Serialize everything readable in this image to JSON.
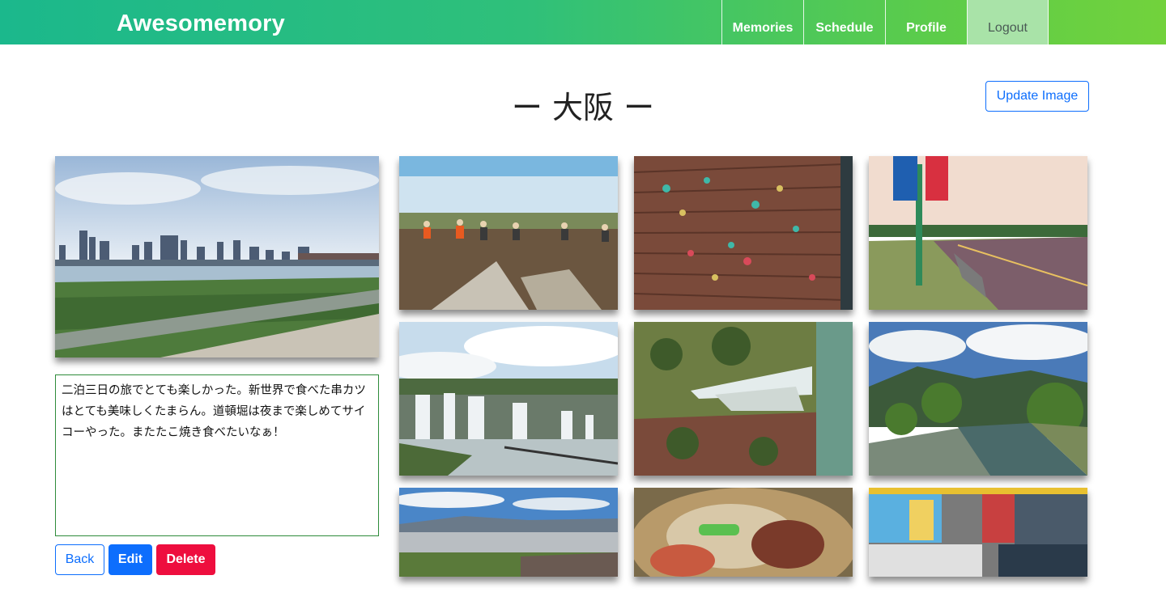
{
  "navbar": {
    "brand": "Awesomemory",
    "items": [
      {
        "label": "Memories"
      },
      {
        "label": "Schedule"
      },
      {
        "label": "Profile"
      },
      {
        "label": "Logout"
      }
    ]
  },
  "page": {
    "title": "ー 大阪 ー",
    "update_image_label": "Update Image"
  },
  "memo": {
    "text": "二泊三日の旅でとても楽しかった。新世界で食べた串カツはとても美味しくたまらん。道頓堀は夜まで楽しめてサイコーやった。またたこ焼き食べたいなぁ！"
  },
  "actions": {
    "back_label": "Back",
    "edit_label": "Edit",
    "delete_label": "Delete"
  },
  "colors": {
    "primary": "#0d6efd",
    "danger": "#ee0e3e",
    "nav_gradient_start": "#1bb88c",
    "nav_gradient_end": "#72d23c"
  }
}
